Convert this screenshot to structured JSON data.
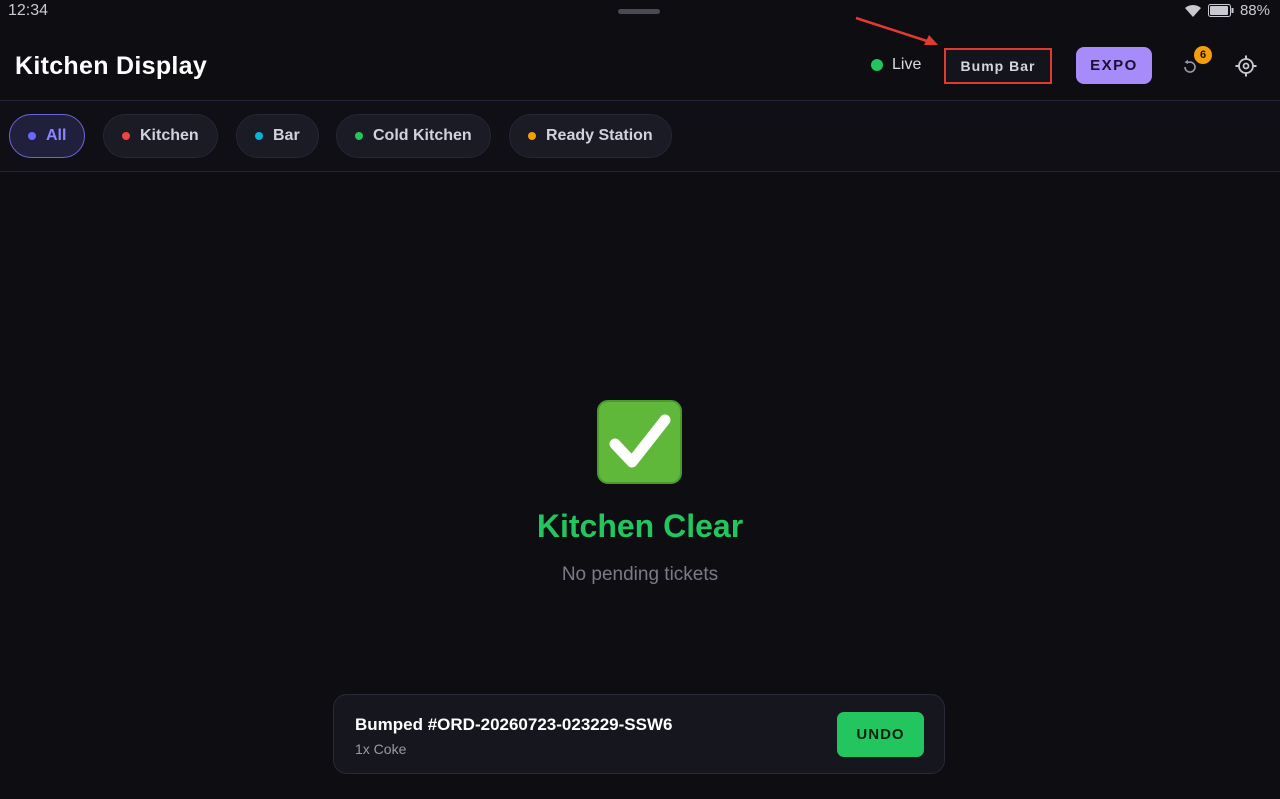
{
  "status_bar": {
    "time": "12:34",
    "battery": "88%"
  },
  "header": {
    "title": "Kitchen Display",
    "live_label": "Live",
    "bump_bar_label": "Bump Bar",
    "expo_label": "EXPO",
    "history_badge": "6"
  },
  "filters": [
    {
      "label": "All",
      "dot_color": "#6b66ff",
      "active": true
    },
    {
      "label": "Kitchen",
      "dot_color": "#ef4444",
      "active": false
    },
    {
      "label": "Bar",
      "dot_color": "#06b6d4",
      "active": false
    },
    {
      "label": "Cold Kitchen",
      "dot_color": "#22c55e",
      "active": false
    },
    {
      "label": "Ready Station",
      "dot_color": "#f59e0b",
      "active": false
    }
  ],
  "empty_state": {
    "title": "Kitchen Clear",
    "subtitle": "No pending tickets"
  },
  "toast": {
    "title": "Bumped #ORD-20260723-023229-SSW6",
    "subtitle": "1x Coke",
    "undo_label": "UNDO"
  },
  "colors": {
    "accent": "#a78bfa",
    "success": "#22c55e",
    "annotation": "#e23a2e"
  }
}
